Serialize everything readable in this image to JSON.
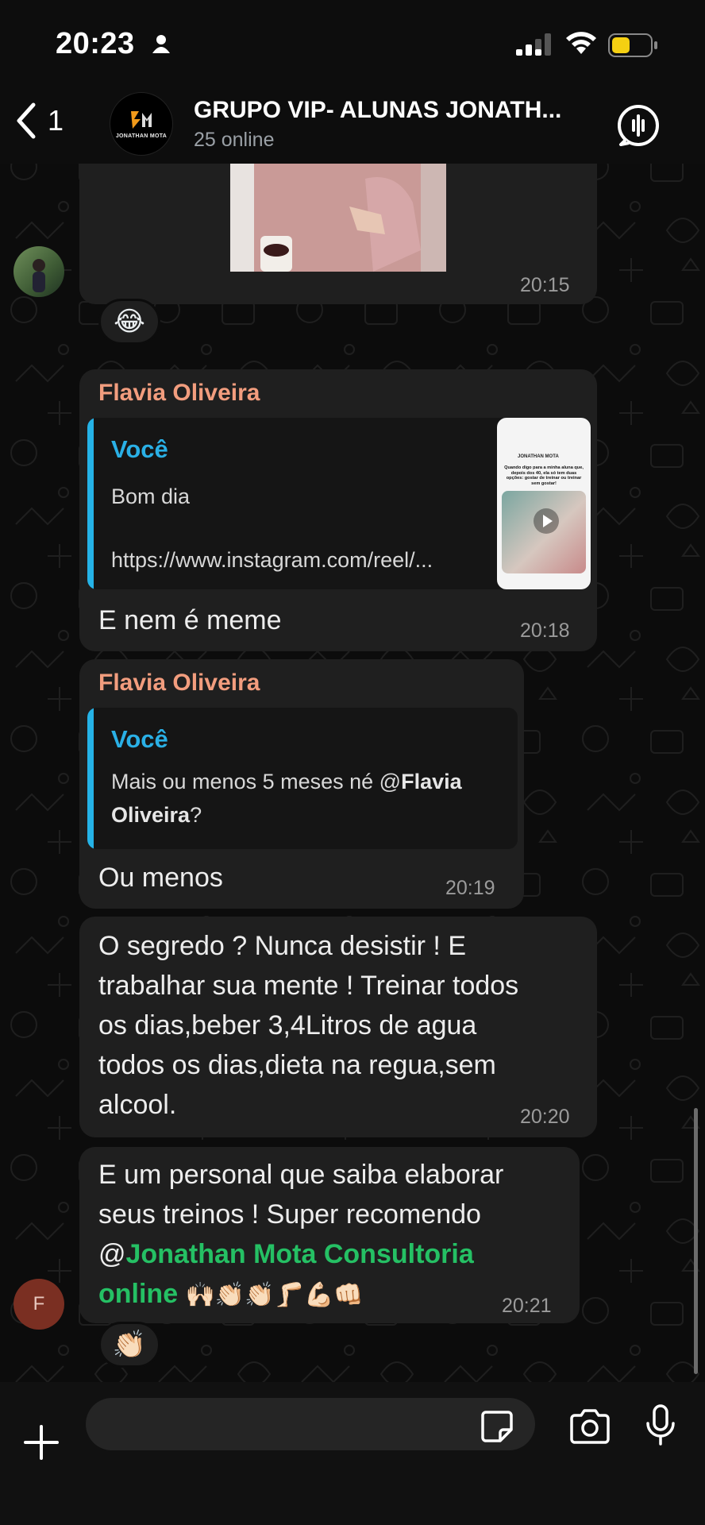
{
  "status_bar": {
    "time": "20:23"
  },
  "header": {
    "back_count": "1",
    "group_name": "GRUPO VIP- ALUNAS JONATH...",
    "online": "25 online",
    "avatar_logo_text": "JONATHAN MOTA"
  },
  "messages": [
    {
      "type": "image",
      "time": "20:15",
      "reaction": "😂"
    },
    {
      "sender": "Flavia Oliveira",
      "quote_author": "Você",
      "quote_line1": "Bom dia",
      "quote_line2": "https://www.instagram.com/reel/...",
      "text": "E nem é meme",
      "time": "20:18",
      "thumbnail": {
        "brand": "JONATHAN MOTA",
        "caption": "Quando digo para a minha aluna que, depois dos 40, ela só tem duas opções: gostar de treinar ou treinar sem gostar!"
      }
    },
    {
      "sender": "Flavia Oliveira",
      "quote_author": "Você",
      "quote_line1": "Mais ou menos 5 meses né @",
      "quote_mention": "Flavia",
      "quote_line2": "Oliveira",
      "quote_line2_suffix": "?",
      "text": "Ou menos",
      "time": "20:19"
    },
    {
      "lines": [
        "O segredo ? Nunca desistir ! E",
        "trabalhar sua mente ! Treinar todos",
        "os dias,beber 3,4Litros de agua",
        "todos os dias,dieta na regua,sem",
        "alcool."
      ],
      "time": "20:20"
    },
    {
      "line1": "E um personal que saiba elaborar",
      "line2": "seus treinos ! Super recomendo",
      "at": "@",
      "mention_line1": "Jonathan Mota Consultoria",
      "mention_line2": "online",
      "emojis": "🙌🏻👏🏻👏🏻🦵🏻💪🏻👊🏻",
      "time": "20:21",
      "reaction": "👏🏻",
      "avatar_initial": "F"
    }
  ],
  "colors": {
    "background": "#0c0c0c",
    "bubble": "#1f1f1f",
    "sender": "#f29d7e",
    "quote_author": "#2ab0e6",
    "mention": "#25c064"
  }
}
